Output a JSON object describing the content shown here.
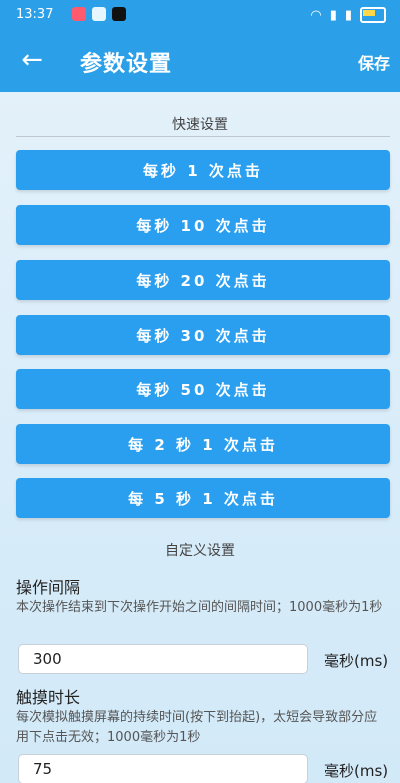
{
  "status": {
    "time": "13:37"
  },
  "header": {
    "title": "参数设置",
    "save_label": "保存"
  },
  "quick": {
    "title": "快速设置",
    "buttons": [
      "每秒 1 次点击",
      "每秒 10 次点击",
      "每秒 20 次点击",
      "每秒 30 次点击",
      "每秒 50 次点击",
      "每 2 秒 1 次点击",
      "每 5 秒 1 次点击"
    ]
  },
  "custom": {
    "title": "自定义设置",
    "interval": {
      "label": "操作间隔",
      "desc": "本次操作结束到下次操作开始之间的间隔时间；1000毫秒为1秒",
      "value": "300",
      "unit": "毫秒(ms)"
    },
    "touch": {
      "label": "触摸时长",
      "desc": "每次模拟触摸屏幕的持续时间(按下到抬起)，太短会导致部分应用下点击无效；1000毫秒为1秒",
      "value": "75",
      "unit": "毫秒(ms)"
    }
  }
}
